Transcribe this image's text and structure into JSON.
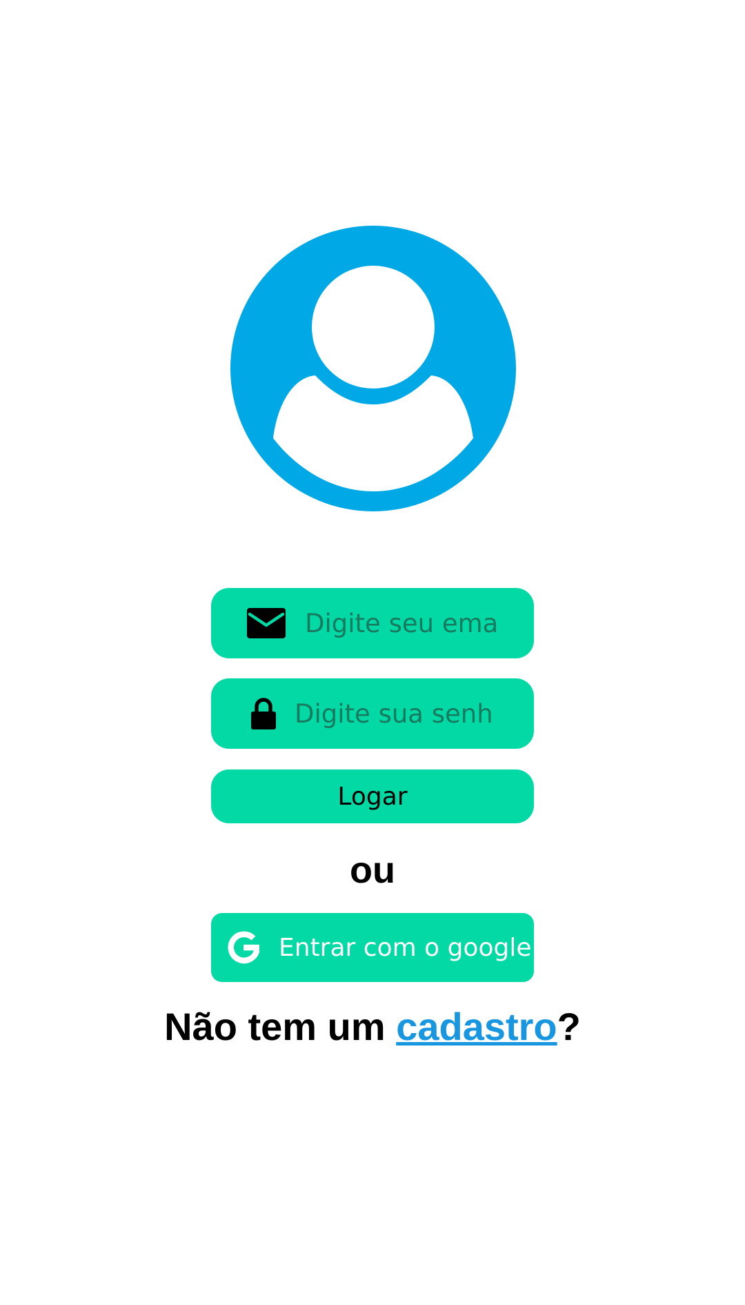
{
  "colors": {
    "accent": "#02d9a5",
    "avatar": "#00a8e6",
    "link": "#1996e0"
  },
  "avatar": {
    "icon": "user-avatar-icon"
  },
  "email_field": {
    "icon": "envelope-icon",
    "placeholder": "Digite seu email",
    "value": ""
  },
  "password_field": {
    "icon": "lock-icon",
    "placeholder": "Digite sua senha",
    "value": ""
  },
  "login_button": {
    "label": "Logar"
  },
  "separator": {
    "text": "ou"
  },
  "google_button": {
    "icon": "google-icon",
    "label": "Entrar com o google"
  },
  "signup": {
    "prefix": "Não tem um ",
    "link_label": "cadastro",
    "suffix": "?"
  }
}
